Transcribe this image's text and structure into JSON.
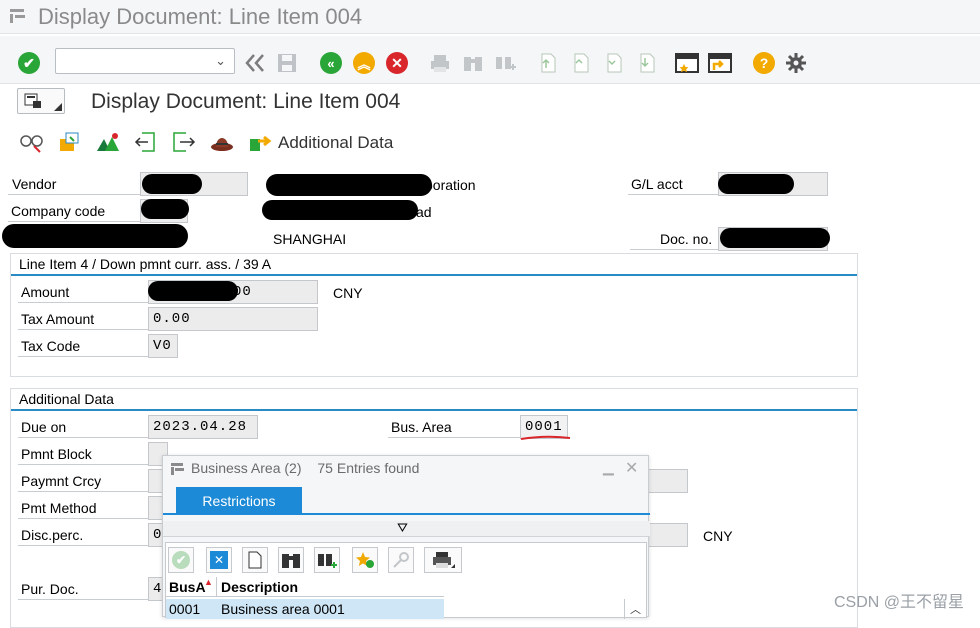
{
  "window": {
    "title": "Display Document: Line Item 004"
  },
  "screen": {
    "title": "Display Document: Line Item 004"
  },
  "app_toolbar": {
    "additional_data_label": "Additional Data"
  },
  "header": {
    "vendor_label": "Vendor",
    "company_code_label": "Company code",
    "gl_acct_label": "G/L acct",
    "doc_no_label": "Doc. no.",
    "vendor_name_tail": "poration",
    "address_tail": "ad",
    "city": "SHANGHAI"
  },
  "line_item": {
    "group_title": "Line Item 4 / Down pmnt curr. ass. / 39 A",
    "amount_label": "Amount",
    "amount_tail": "00",
    "currency": "CNY",
    "tax_amount_label": "Tax Amount",
    "tax_amount": "0.00",
    "tax_code_label": "Tax Code",
    "tax_code": "V0"
  },
  "additional_data": {
    "group_title": "Additional Data",
    "due_on_label": "Due on",
    "due_on": "2023.04.28",
    "bus_area_label": "Bus. Area",
    "bus_area": "0001",
    "pmnt_block_label": "Pmnt Block",
    "paymnt_crcy_label": "Paymnt Crcy",
    "pmt_method_label": "Pmt Method",
    "disc_perc_label": "Disc.perc.",
    "disc_perc_partial": "0",
    "disc_currency": "CNY",
    "pur_doc_label": "Pur. Doc.",
    "pur_doc_partial": "4"
  },
  "popup": {
    "title": "Business Area (2)",
    "entries": "75 Entries found",
    "tab_label": "Restrictions",
    "columns": [
      "BusA",
      "Description"
    ],
    "rows": [
      {
        "code": "0001",
        "description": "Business area 0001"
      }
    ]
  },
  "watermark": "CSDN @王不留星"
}
